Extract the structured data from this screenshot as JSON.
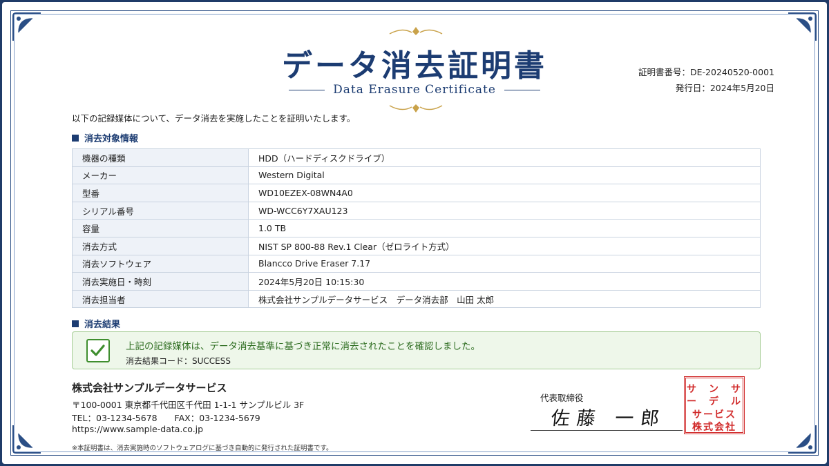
{
  "header": {
    "title": "データ消去証明書",
    "subtitle": "Data Erasure Certificate",
    "certificate_no": "証明書番号：DE-20240520-0001",
    "issue_date": "発行日：2024年5月20日"
  },
  "intro": "以下の記録媒体について、データ消去を実施したことを証明いたします。",
  "target_section": {
    "heading": "消去対象情報",
    "rows": [
      {
        "label": "機器の種類",
        "value": "HDD（ハードディスクドライブ）"
      },
      {
        "label": "メーカー",
        "value": "Western Digital"
      },
      {
        "label": "型番",
        "value": "WD10EZEX-08WN4A0"
      },
      {
        "label": "シリアル番号",
        "value": "WD-WCC6Y7XAU123"
      },
      {
        "label": "容量",
        "value": "1.0 TB"
      },
      {
        "label": "消去方式",
        "value": "NIST SP 800-88 Rev.1 Clear（ゼロライト方式）"
      },
      {
        "label": "消去ソフトウェア",
        "value": "Blancco Drive Eraser 7.17"
      },
      {
        "label": "消去実施日・時刻",
        "value": "2024年5月20日 10:15:30"
      },
      {
        "label": "消去担当者",
        "value": "株式会社サンプルデータサービス　データ消去部　山田 太郎"
      }
    ]
  },
  "result_section": {
    "heading": "消去結果",
    "message": "上記の記録媒体は、データ消去基準に基づき正常に消去されたことを確認しました。",
    "code": "消去結果コード：SUCCESS",
    "status_color": "#3e8e2e"
  },
  "issuer": {
    "company": "株式会社サンプルデータサービス",
    "address": "〒100-0001 東京都千代田区千代田 1-1-1 サンプルビル 3F",
    "phone_fax": "TEL：03-1234-5678　　FAX：03-1234-5679",
    "url": "https://www.sample-data.co.jp",
    "note": "※本証明書は、消去実施時のソフトウェアログに基づき自動的に発行された証明書です。"
  },
  "signature": {
    "title": "代表取締役",
    "name": "佐藤 一郎",
    "seal_rows": [
      "サ　ン　サ",
      "ー　デ　ル",
      "サービス",
      "株式会社"
    ]
  },
  "colors": {
    "navy": "#1c3c72",
    "seal_red": "#d12b2b",
    "success_green": "#3e8e2e"
  }
}
